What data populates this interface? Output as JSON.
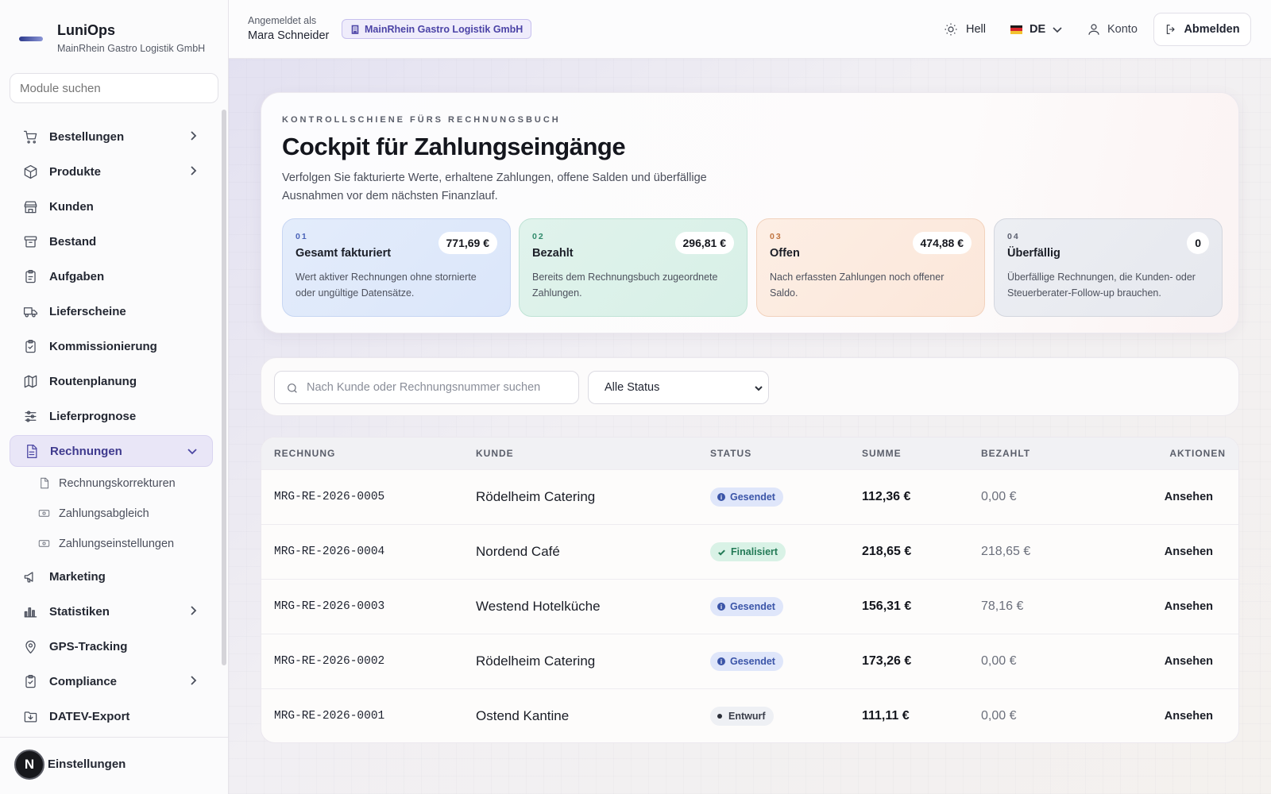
{
  "app": {
    "name": "LuniOps",
    "org": "MainRhein Gastro Logistik GmbH"
  },
  "sidebar": {
    "search_placeholder": "Module suchen",
    "items": [
      {
        "label": "Bestellungen",
        "icon": "cart-icon",
        "chevron": true
      },
      {
        "label": "Produkte",
        "icon": "box-icon",
        "chevron": true
      },
      {
        "label": "Kunden",
        "icon": "store-icon",
        "chevron": false
      },
      {
        "label": "Bestand",
        "icon": "archive-icon",
        "chevron": false
      },
      {
        "label": "Aufgaben",
        "icon": "clipboard-icon",
        "chevron": false
      },
      {
        "label": "Lieferscheine",
        "icon": "truck-icon",
        "chevron": false
      },
      {
        "label": "Kommissionierung",
        "icon": "clipboard-check-icon",
        "chevron": false
      },
      {
        "label": "Routenplanung",
        "icon": "map-icon",
        "chevron": false
      },
      {
        "label": "Lieferprognose",
        "icon": "sliders-icon",
        "chevron": false
      },
      {
        "label": "Rechnungen",
        "icon": "file-icon",
        "chevron": true,
        "active": true
      },
      {
        "label": "Marketing",
        "icon": "megaphone-icon",
        "chevron": false
      },
      {
        "label": "Statistiken",
        "icon": "bar-chart-icon",
        "chevron": true
      },
      {
        "label": "GPS-Tracking",
        "icon": "map-pin-icon",
        "chevron": false
      },
      {
        "label": "Compliance",
        "icon": "clipboard-icon",
        "chevron": true
      },
      {
        "label": "DATEV-Export",
        "icon": "folder-down-icon",
        "chevron": false
      }
    ],
    "subitems": [
      {
        "label": "Rechnungskorrekturen",
        "icon": "file-icon"
      },
      {
        "label": "Zahlungsabgleich",
        "icon": "banknote-icon"
      },
      {
        "label": "Zahlungseinstellungen",
        "icon": "banknote-icon"
      }
    ],
    "settings_label": "Einstellungen",
    "avatar_letter": "N"
  },
  "header": {
    "signed_in_label": "Angemeldet als",
    "user_name": "Mara Schneider",
    "org_badge": "MainRhein Gastro Logistik GmbH",
    "theme_label": "Hell",
    "lang_label": "DE",
    "account_label": "Konto",
    "logout_label": "Abmelden"
  },
  "hero": {
    "eyebrow": "KONTROLLSCHIENE FÜRS RECHNUNGSBUCH",
    "title": "Cockpit für Zahlungseingänge",
    "description": "Verfolgen Sie fakturierte Werte, erhaltene Zahlungen, offene Salden und überfällige Ausnahmen vor dem nächsten Finanzlauf."
  },
  "kpis": [
    {
      "num": "01",
      "title": "Gesamt fakturiert",
      "value": "771,69 €",
      "desc": "Wert aktiver Rechnungen ohne stornierte oder ungültige Datensätze."
    },
    {
      "num": "02",
      "title": "Bezahlt",
      "value": "296,81 €",
      "desc": "Bereits dem Rechnungsbuch zugeordnete Zahlungen."
    },
    {
      "num": "03",
      "title": "Offen",
      "value": "474,88 €",
      "desc": "Nach erfassten Zahlungen noch offener Saldo."
    },
    {
      "num": "04",
      "title": "Überfällig",
      "value": "0",
      "desc": "Überfällige Rechnungen, die Kunden- oder Steuerberater-Follow-up brauchen."
    }
  ],
  "filters": {
    "search_placeholder": "Nach Kunde oder Rechnungsnummer suchen",
    "status_value": "Alle Status"
  },
  "table": {
    "headers": [
      "RECHNUNG",
      "KUNDE",
      "STATUS",
      "SUMME",
      "BEZAHLT",
      "AKTIONEN"
    ],
    "rows": [
      {
        "invoice": "MRG-RE-2026-0005",
        "customer": "Rödelheim Catering",
        "status": "Gesendet",
        "status_type": "sent",
        "total": "112,36 €",
        "paid": "0,00 €",
        "action": "Ansehen"
      },
      {
        "invoice": "MRG-RE-2026-0004",
        "customer": "Nordend Café",
        "status": "Finalisiert",
        "status_type": "final",
        "total": "218,65 €",
        "paid": "218,65 €",
        "action": "Ansehen"
      },
      {
        "invoice": "MRG-RE-2026-0003",
        "customer": "Westend Hotelküche",
        "status": "Gesendet",
        "status_type": "sent",
        "total": "156,31 €",
        "paid": "78,16 €",
        "action": "Ansehen"
      },
      {
        "invoice": "MRG-RE-2026-0002",
        "customer": "Rödelheim Catering",
        "status": "Gesendet",
        "status_type": "sent",
        "total": "173,26 €",
        "paid": "0,00 €",
        "action": "Ansehen"
      },
      {
        "invoice": "MRG-RE-2026-0001",
        "customer": "Ostend Kantine",
        "status": "Entwurf",
        "status_type": "draft",
        "total": "111,11 €",
        "paid": "0,00 €",
        "action": "Ansehen"
      }
    ]
  }
}
